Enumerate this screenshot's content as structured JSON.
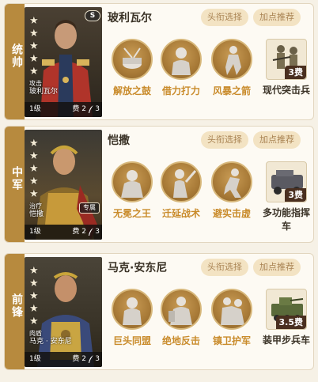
{
  "colors": {
    "position_bar": "#b78a3e",
    "skill_label": "#c98b2b",
    "button_bg": "#f3e3c3",
    "button_text": "#a98353",
    "cost_badge": "#4a2f1f"
  },
  "cards": [
    {
      "position": "统帅",
      "name": "玻利瓦尔",
      "stars": 5,
      "role": "攻击",
      "portrait_name": "玻利瓦尔",
      "portrait_badge": "",
      "level": "1级",
      "cost": "费 2",
      "points": "3",
      "buttons": {
        "title": "头衔选择",
        "points": "加点推荐"
      },
      "skills": [
        {
          "label": "解放之鼓",
          "icon": "drum-icon"
        },
        {
          "label": "借力打力",
          "icon": "fist-icon"
        },
        {
          "label": "风暴之箭",
          "icon": "arrow-icon"
        }
      ],
      "unit": {
        "label": "现代突击兵",
        "cost": "3费",
        "icon": "soldiers-icon"
      }
    },
    {
      "position": "中军",
      "name": "恺撒",
      "stars": 5,
      "role": "治疗",
      "portrait_name": "恺撒",
      "portrait_badge": "专属",
      "level": "1级",
      "cost": "费 2",
      "points": "3",
      "buttons": {
        "title": "头衔选择",
        "points": "加点推荐"
      },
      "skills": [
        {
          "label": "无冕之王",
          "icon": "crown-icon"
        },
        {
          "label": "迁延战术",
          "icon": "sword-icon"
        },
        {
          "label": "避实击虚",
          "icon": "strike-icon"
        }
      ],
      "unit": {
        "label": "多功能指挥车",
        "cost": "3费",
        "icon": "command-vehicle-icon"
      }
    },
    {
      "position": "前锋",
      "name": "马克·安东尼",
      "stars": 5,
      "role": "肉盾",
      "portrait_name": "马克 · 安东尼",
      "portrait_badge": "",
      "level": "1级",
      "cost": "费 2",
      "points": "3",
      "buttons": {
        "title": "头衔选择",
        "points": "加点推荐"
      },
      "skills": [
        {
          "label": "巨头同盟",
          "icon": "alliance-icon"
        },
        {
          "label": "绝地反击",
          "icon": "counter-icon"
        },
        {
          "label": "镇卫护军",
          "icon": "guard-icon"
        }
      ],
      "unit": {
        "label": "装甲步兵车",
        "cost": "3.5费",
        "icon": "armored-vehicle-icon"
      }
    }
  ]
}
